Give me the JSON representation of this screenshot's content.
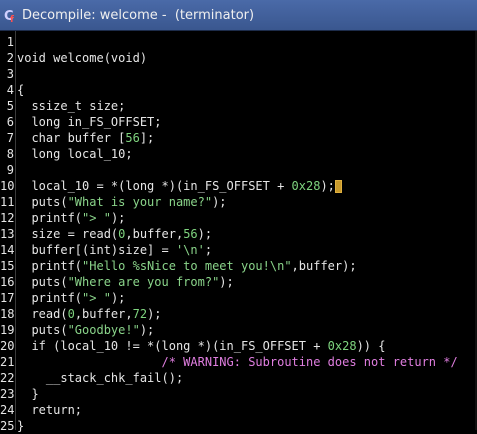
{
  "window": {
    "title": "Decompile: welcome -  (terminator)",
    "accent": "#3f5f9c"
  },
  "code": {
    "lines": [
      {
        "n": "1",
        "t": ""
      },
      {
        "n": "2",
        "t": "void welcome(void)"
      },
      {
        "n": "3",
        "t": ""
      },
      {
        "n": "4",
        "t": "{"
      },
      {
        "n": "5",
        "t": "  ssize_t size;"
      },
      {
        "n": "6",
        "t": "  long in_FS_OFFSET;"
      },
      {
        "n": "7",
        "t": "  char buffer [56];"
      },
      {
        "n": "8",
        "t": "  long local_10;"
      },
      {
        "n": "9",
        "t": "  "
      },
      {
        "n": "10",
        "t": "  local_10 = *(long *)(in_FS_OFFSET + 0x28);"
      },
      {
        "n": "11",
        "t": "  puts(\"What is your name?\");"
      },
      {
        "n": "12",
        "t": "  printf(\"> \");"
      },
      {
        "n": "13",
        "t": "  size = read(0,buffer,56);"
      },
      {
        "n": "14",
        "t": "  buffer[(int)size] = '\\n';"
      },
      {
        "n": "15",
        "t": "  printf(\"Hello %sNice to meet you!\\n\",buffer);"
      },
      {
        "n": "16",
        "t": "  puts(\"Where are you from?\");"
      },
      {
        "n": "17",
        "t": "  printf(\"> \");"
      },
      {
        "n": "18",
        "t": "  read(0,buffer,72);"
      },
      {
        "n": "19",
        "t": "  puts(\"Goodbye!\");"
      },
      {
        "n": "20",
        "t": "  if (local_10 != *(long *)(in_FS_OFFSET + 0x28)) {"
      },
      {
        "n": "21",
        "t": "                    /* WARNING: Subroutine does not return */"
      },
      {
        "n": "22",
        "t": "    __stack_chk_fail();"
      },
      {
        "n": "23",
        "t": "  }"
      },
      {
        "n": "24",
        "t": "  return;"
      },
      {
        "n": "25",
        "t": "}"
      }
    ]
  }
}
